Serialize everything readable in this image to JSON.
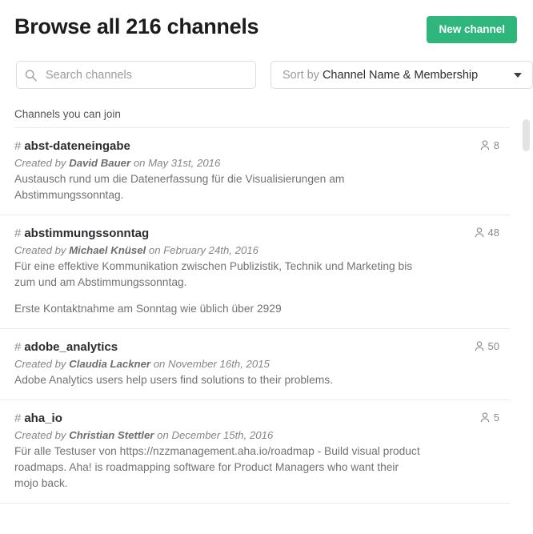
{
  "header": {
    "title": "Browse all 216 channels",
    "new_channel_label": "New channel",
    "accent_color": "#2eb67d"
  },
  "search": {
    "placeholder": "Search channels",
    "value": "",
    "icon": "search-icon"
  },
  "sort": {
    "label": "Sort by",
    "value": "Channel Name & Membership",
    "caret_icon": "chevron-down-icon"
  },
  "section": {
    "label": "Channels you can join"
  },
  "channels": [
    {
      "hash": "#",
      "name": "abst-dateneingabe",
      "created_prefix": "Created by ",
      "author": "David Bauer",
      "created_suffix": " on May 31st, 2016",
      "purpose": "Austausch rund um die Datenerfassung für die Visualisierungen am Abstimmungssonntag.",
      "purpose2": "",
      "members": "8",
      "member_icon": "user-icon"
    },
    {
      "hash": "#",
      "name": "abstimmungssonntag",
      "created_prefix": "Created by ",
      "author": "Michael Knüsel",
      "created_suffix": " on February 24th, 2016",
      "purpose": "Für eine effektive Kommunikation zwischen Publizistik, Technik und Marketing bis zum und am Abstimmungssonntag.",
      "purpose2": "Erste Kontaktnahme am Sonntag wie üblich über 2929",
      "members": "48",
      "member_icon": "user-icon"
    },
    {
      "hash": "#",
      "name": "adobe_analytics",
      "created_prefix": "Created by ",
      "author": "Claudia Lackner",
      "created_suffix": " on November 16th, 2015",
      "purpose": "Adobe Analytics users help users find solutions to their problems.",
      "purpose2": "",
      "members": "50",
      "member_icon": "user-icon"
    },
    {
      "hash": "#",
      "name": "aha_io",
      "created_prefix": "Created by ",
      "author": "Christian Stettler",
      "created_suffix": " on December 15th, 2016",
      "purpose": "Für alle Testuser von https://nzzmanagement.aha.io/roadmap -  Build visual product roadmaps. Aha! is roadmapping software for Product Managers who want their mojo back.",
      "purpose2": "",
      "members": "5",
      "member_icon": "user-icon"
    }
  ]
}
